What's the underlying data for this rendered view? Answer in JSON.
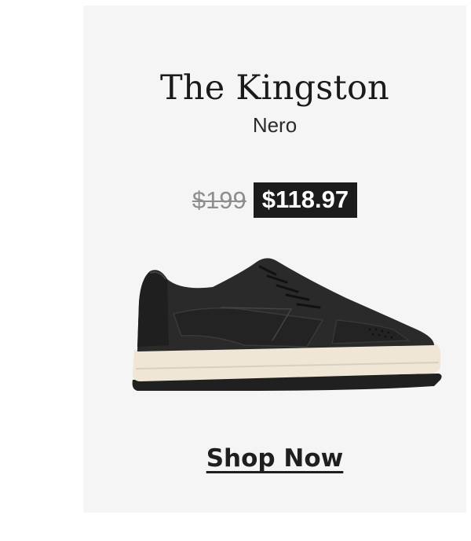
{
  "product": {
    "title": "The Kingston",
    "color_name": "Nero",
    "original_price": "$199",
    "sale_price": "$118.97"
  },
  "cta": {
    "label": "Shop Now"
  },
  "colors": {
    "card_background": "#f5f5f5",
    "price_badge_background": "#1c1c1c",
    "strikethrough_price": "#8e8e8e",
    "shoe_upper": "#2a2a2a",
    "shoe_midsole": "#efe6d6"
  },
  "icons": {
    "product_image": "black-leather-sneaker-image"
  }
}
